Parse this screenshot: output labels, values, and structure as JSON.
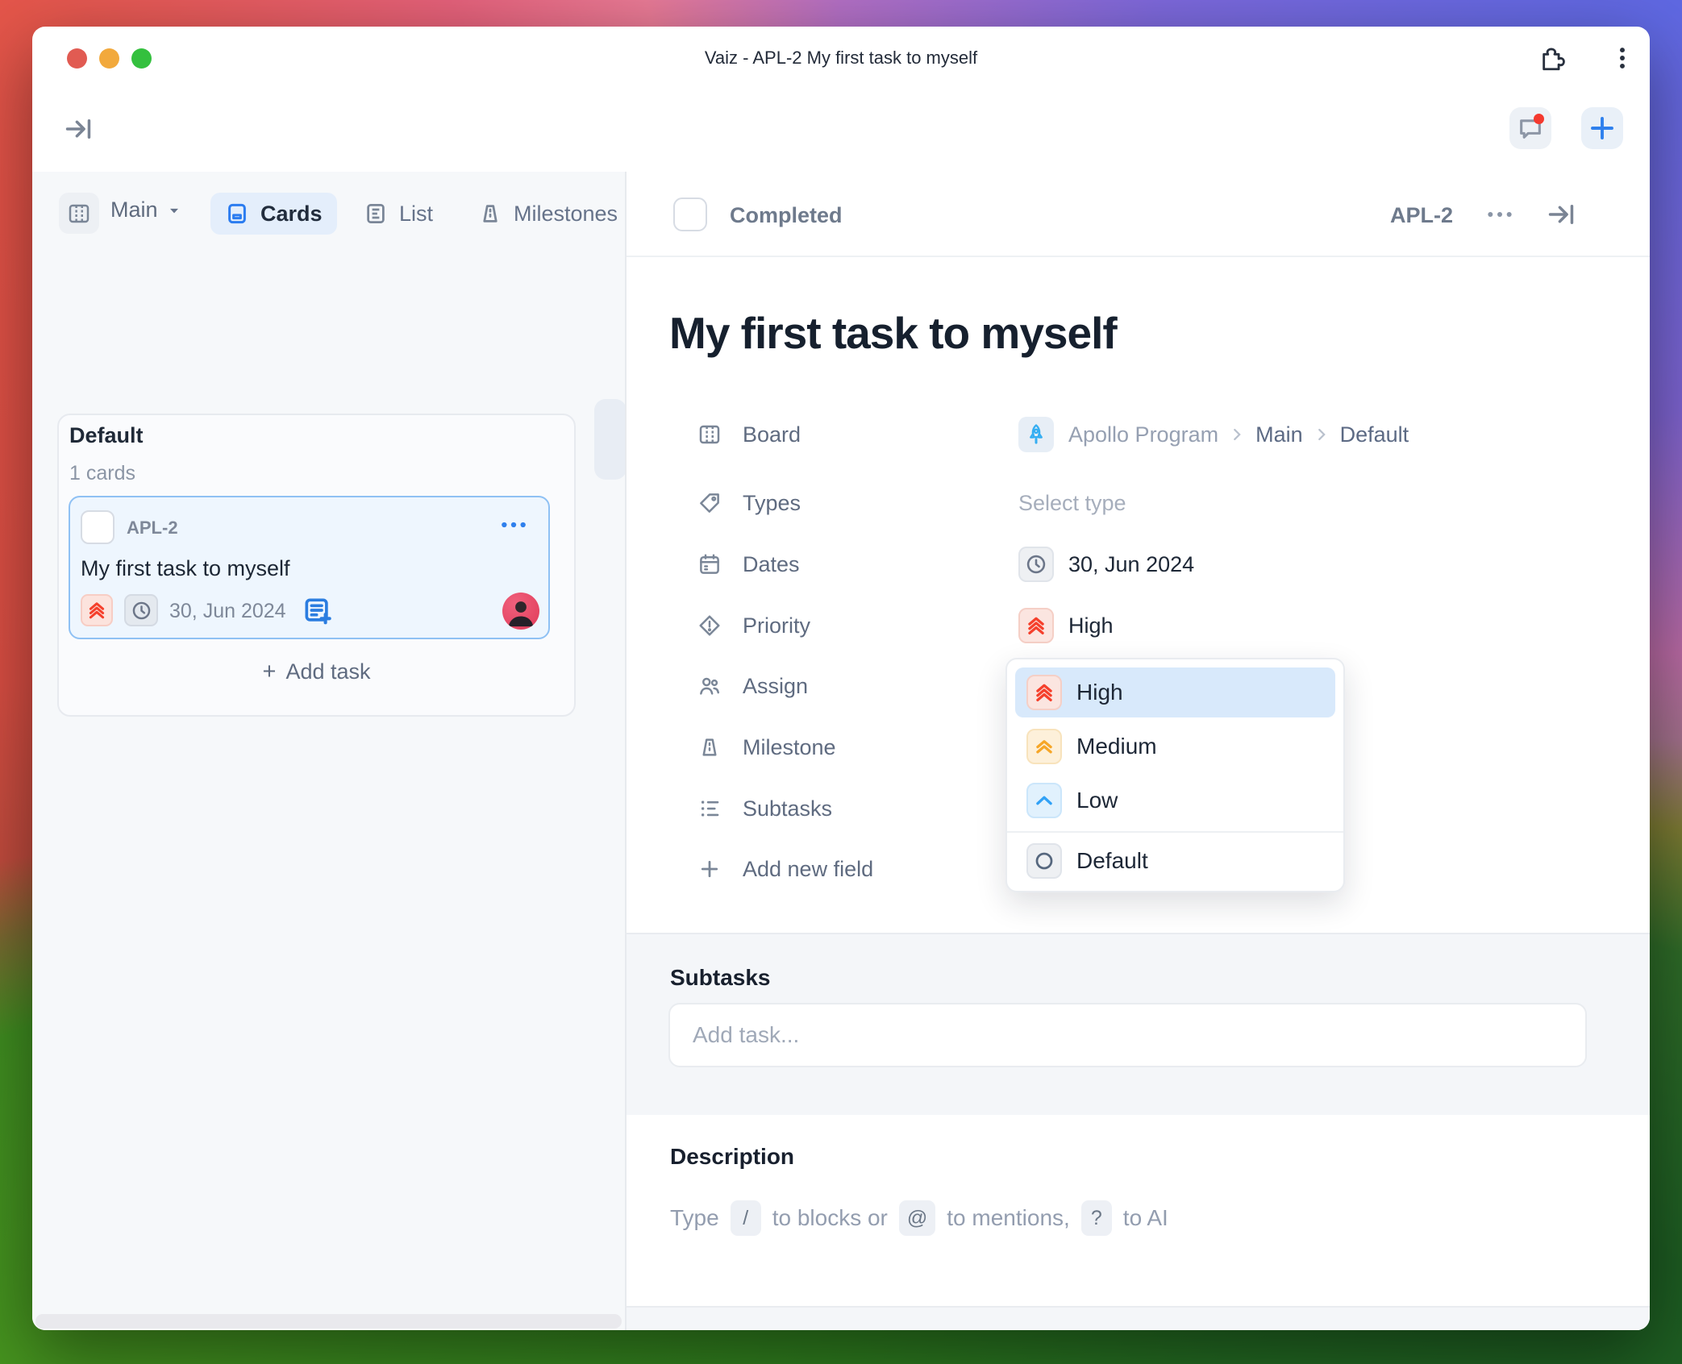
{
  "window_title": "Vaiz - APL-2 My first task to myself",
  "left_panel": {
    "view_name": "Main",
    "tabs": {
      "cards": "Cards",
      "list": "List",
      "milestones": "Milestones"
    },
    "column": {
      "title": "Default",
      "count": "1 cards",
      "add_task": "Add task",
      "card": {
        "key": "APL-2",
        "title": "My first task to myself",
        "date": "30, Jun 2024"
      }
    }
  },
  "task": {
    "header": {
      "completed": "Completed",
      "key": "APL-2"
    },
    "title": "My first task to myself",
    "fields": {
      "board": {
        "label": "Board",
        "breadcrumb": [
          "Apollo Program",
          "Main",
          "Default"
        ]
      },
      "types": {
        "label": "Types",
        "placeholder": "Select type"
      },
      "dates": {
        "label": "Dates",
        "value": "30, Jun 2024"
      },
      "priority": {
        "label": "Priority",
        "value": "High"
      },
      "assign": {
        "label": "Assign"
      },
      "milestone": {
        "label": "Milestone"
      },
      "subtasks": {
        "label": "Subtasks"
      },
      "add_new_field": "Add new field"
    },
    "priority_dropdown": {
      "high": "High",
      "medium": "Medium",
      "low": "Low",
      "default": "Default"
    },
    "subtasks_section": {
      "heading": "Subtasks",
      "placeholder": "Add task..."
    },
    "description_section": {
      "heading": "Description",
      "ph": {
        "t1": "Type",
        "k1": "/",
        "t2": "to blocks or",
        "k2": "@",
        "t3": "to mentions,",
        "k3": "?",
        "t4": "to AI"
      }
    }
  },
  "colors": {
    "accent_blue": "#2f80ed",
    "priority_high_red": "#f5402c",
    "priority_medium_orange": "#f6a627",
    "priority_low_blue": "#31a1f6",
    "selected_option_bg": "#d8e9fb",
    "card_bg": "#eef6fe",
    "card_border": "#8fc1f4",
    "panel_bg": "#f6f8fa",
    "rocket_blue": "#35aef2",
    "notification_red": "#f4392e"
  },
  "icons": {
    "traffic": [
      "close-circle",
      "minimize-circle",
      "zoom-circle"
    ],
    "titlebar": [
      "extensions-puzzle-icon",
      "kebab-menu-icon"
    ],
    "toolbar": [
      "collapse-sidebar-icon",
      "chat-icon",
      "plus-icon"
    ],
    "tabs": [
      "board-view-icon",
      "cards-icon",
      "list-icon",
      "milestones-icon"
    ],
    "fields": [
      "board-icon",
      "tag-icon",
      "calendar-icon",
      "priority-diamond-icon",
      "assign-people-icon",
      "milestone-icon",
      "subtasks-icon",
      "plus-icon",
      "clock-icon",
      "rocket-icon"
    ],
    "priority": [
      "chevrons-high-icon",
      "chevrons-medium-icon",
      "chevron-low-icon",
      "circle-default-icon"
    ]
  }
}
